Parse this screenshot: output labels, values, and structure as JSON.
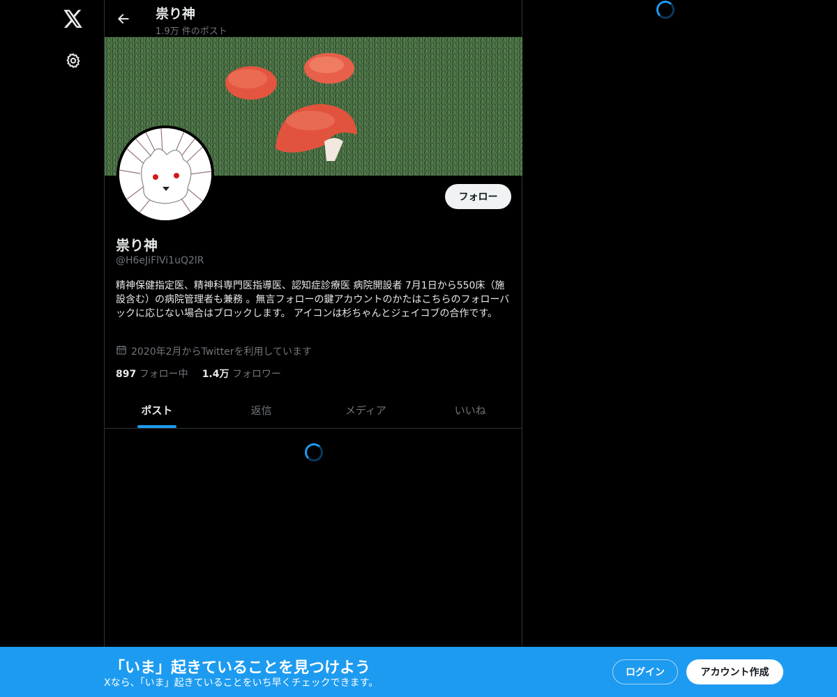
{
  "nav": {
    "logo_icon": "x-logo-icon",
    "settings_icon": "gear-icon"
  },
  "header": {
    "back_icon": "arrow-left-icon",
    "title": "祟り神",
    "post_count": "1.9万 件のポスト"
  },
  "profile": {
    "name": "祟り神",
    "handle": "@H6eJiFlVi1uQ2lR",
    "follow_label": "フォロー",
    "bio": "精神保健指定医、精神科専門医指導医、認知症診療医 病院開設者 7月1日から550床（施設含む）の病院管理者も兼務 。無言フォローの鍵アカウントのかたはこちらのフォローバックに応じない場合はブロックします。 アイコンは杉ちゃんとジェイコブの合作です。",
    "joined": "2020年2月からTwitterを利用しています",
    "following_count": "897",
    "following_label": "フォロー中",
    "followers_count": "1.4万",
    "followers_label": "フォロワー"
  },
  "tabs": [
    {
      "label": "ポスト",
      "active": true
    },
    {
      "label": "返信",
      "active": false
    },
    {
      "label": "メディア",
      "active": false
    },
    {
      "label": "いいね",
      "active": false
    }
  ],
  "bottom_bar": {
    "title": "「いま」起きていることを見つけよう",
    "subtitle": "Xなら、「いま」起きていることをいち早くチェックできます。",
    "login_label": "ログイン",
    "signup_label": "アカウント作成"
  },
  "colors": {
    "accent": "#1d9bf0",
    "background": "#000000",
    "muted": "#71767b"
  }
}
